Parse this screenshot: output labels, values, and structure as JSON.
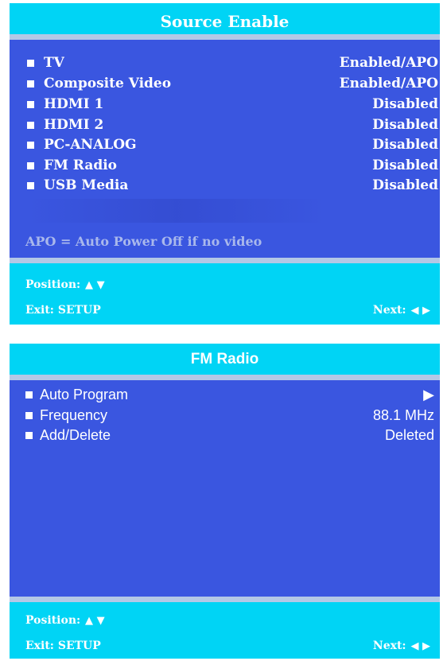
{
  "source_enable": {
    "title": "Source Enable",
    "items": [
      {
        "label": "TV",
        "value": "Enabled/APO"
      },
      {
        "label": "Composite Video",
        "value": "Enabled/APO"
      },
      {
        "label": "HDMI 1",
        "value": "Disabled"
      },
      {
        "label": "HDMI 2",
        "value": "Disabled"
      },
      {
        "label": "PC-ANALOG",
        "value": "Disabled"
      },
      {
        "label": "FM Radio",
        "value": "Disabled"
      },
      {
        "label": "USB Media",
        "value": "Disabled"
      }
    ],
    "note": "APO = Auto Power Off if no video",
    "footer": {
      "position_label": "Position:",
      "position_icons": "▲ ▼",
      "exit_label": "Exit: SETUP",
      "next_label": "Next:",
      "next_icons": "◀ ▶"
    }
  },
  "fm_radio": {
    "title": "FM Radio",
    "items": [
      {
        "label": "Auto Program",
        "value": "▶"
      },
      {
        "label": "Frequency",
        "value": "88.1 MHz"
      },
      {
        "label": "Add/Delete",
        "value": "Deleted"
      }
    ],
    "footer": {
      "position_label": "Position:",
      "position_icons": "▲ ▼",
      "exit_label": "Exit: SETUP",
      "next_label": "Next:",
      "next_icons": "◀ ▶"
    }
  },
  "colors": {
    "panel_blue": "#3a56e0",
    "bar_cyan": "#00d4f5",
    "divider": "#b4c8e6",
    "text": "#ffffff",
    "note_text": "#a9b8ec"
  }
}
